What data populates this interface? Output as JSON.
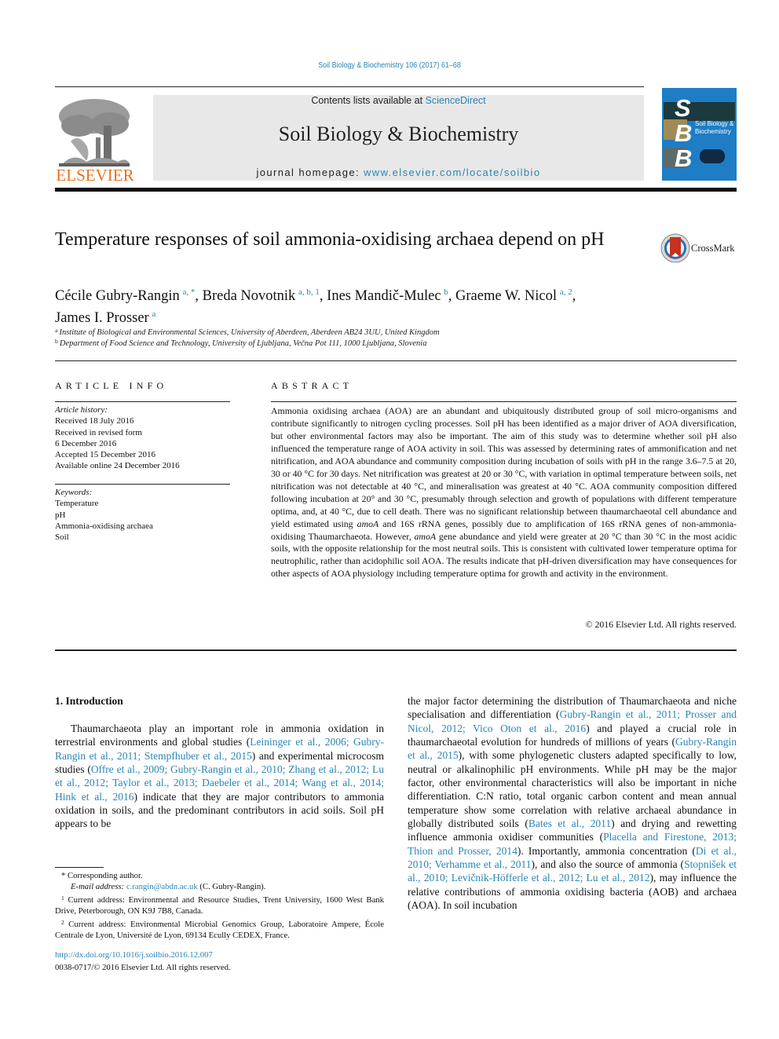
{
  "header": {
    "running_head": "Soil Biology & Biochemistry 106 (2017) 61–68",
    "contents_prefix": "Contents lists available at ",
    "contents_link": "ScienceDirect",
    "journal_title": "Soil Biology & Biochemistry",
    "homepage_prefix": "journal homepage: ",
    "homepage_link": "www.elsevier.com/locate/soilbio",
    "publisher_logo_text": "ELSEVIER",
    "cover": {
      "letters": [
        "S",
        "B",
        "B"
      ],
      "title_line1": "Soil Biology &",
      "title_line2": "Biochemistry"
    },
    "colors": {
      "link": "#2a85b5",
      "elsevier_orange": "#e9711c",
      "cover_blue": "#1e7dc4",
      "banner_gray": "#e8e8e8"
    }
  },
  "article": {
    "title": "Temperature responses of soil ammonia-oxidising archaea depend on pH",
    "crossmark_label": "CrossMark",
    "authors": [
      {
        "name": "Cécile Gubry-Rangin",
        "sup": "a, *",
        "sep": ", "
      },
      {
        "name": "Breda Novotnik",
        "sup": "a, b, 1",
        "sep": ", "
      },
      {
        "name": "Ines Mandič-Mulec",
        "sup": "b",
        "sep": ", "
      },
      {
        "name": "Graeme W. Nicol",
        "sup": "a, 2",
        "sep": ","
      },
      {
        "name": "James I. Prosser",
        "sup": "a",
        "sep": ""
      }
    ],
    "affiliations": [
      {
        "key": "a",
        "text": "Institute of Biological and Environmental Sciences, University of Aberdeen, Aberdeen AB24 3UU, United Kingdom"
      },
      {
        "key": "b",
        "text": "Department of Food Science and Technology, University of Ljubljana, Večna Pot 111, 1000 Ljubljana, Slovenia"
      }
    ]
  },
  "article_info": {
    "heading": "ARTICLE INFO",
    "history_label": "Article history:",
    "history": [
      "Received 18 July 2016",
      "Received in revised form",
      "6 December 2016",
      "Accepted 15 December 2016",
      "Available online 24 December 2016"
    ],
    "keywords_label": "Keywords:",
    "keywords": [
      "Temperature",
      "pH",
      "Ammonia-oxidising archaea",
      "Soil"
    ]
  },
  "abstract": {
    "heading": "ABSTRACT",
    "parts": [
      "Ammonia oxidising archaea (AOA) are an abundant and ubiquitously distributed group of soil micro-organisms and contribute significantly to nitrogen cycling processes. Soil pH has been identified as a major driver of AOA diversification, but other environmental factors may also be important. The aim of this study was to determine whether soil pH also influenced the temperature range of AOA activity in soil. This was assessed by determining rates of ammonification and net nitrification, and AOA abundance and community composition during incubation of soils with pH in the range 3.6–7.5 at 20, 30 or 40 °C for 30 days. Net nitrification was greatest at 20 or 30 °C, with variation in optimal temperature between soils, net nitrification was not detectable at 40 °C, and mineralisation was greatest at 40 °C. AOA community composition differed following incubation at 20° and 30 °C, presumably through selection and growth of populations with different temperature optima, and, at 40 °C, due to cell death. There was no significant relationship between thaumarchaeotal cell abundance and yield estimated using ",
      "amoA",
      " and 16S rRNA genes, possibly due to amplification of 16S rRNA genes of non-ammonia-oxidising Thaumarchaeota. However, ",
      "amoA",
      " gene abundance and yield were greater at 20 °C than 30 °C in the most acidic soils, with the opposite relationship for the most neutral soils. This is consistent with cultivated lower temperature optima for neutrophilic, rather than acidophilic soil AOA. The results indicate that pH-driven diversification may have consequences for other aspects of AOA physiology including temperature optima for growth and activity in the environment."
    ],
    "copyright": "© 2016 Elsevier Ltd. All rights reserved."
  },
  "introduction": {
    "heading": "1.  Introduction",
    "left_column": [
      {
        "t": "Thaumarchaeota play an important role in ammonia oxidation in terrestrial environments and global studies ("
      },
      {
        "t": "Leininger et al., 2006; Gubry-Rangin et al., 2011; Stempfhuber et al., 2015",
        "link": true
      },
      {
        "t": ") and experimental microcosm studies ("
      },
      {
        "t": "Offre et al., 2009; Gubry-Rangin et al., 2010; Zhang et al., 2012; Lu et al., 2012; Taylor et al., 2013; Daebeler et al., 2014; Wang et al., 2014; Hink et al., 2016",
        "link": true
      },
      {
        "t": ") indicate that they are major contributors to ammonia oxidation in soils, and the predominant contributors in acid soils. Soil pH appears to be"
      }
    ],
    "right_column": [
      {
        "t": "the major factor determining the distribution of Thaumarchaeota and niche specialisation and differentiation ("
      },
      {
        "t": "Gubry-Rangin et al., 2011; Prosser and Nicol, 2012; Vico Oton et al., 2016",
        "link": true
      },
      {
        "t": ") and played a crucial role in thaumarchaeotal evolution for hundreds of millions of years ("
      },
      {
        "t": "Gubry-Rangin et al., 2015",
        "link": true
      },
      {
        "t": "), with some phylogenetic clusters adapted specifically to low, neutral or alkalinophilic pH environments. While pH may be the major factor, other environmental characteristics will also be important in niche differentiation. C:N ratio, total organic carbon content and mean annual temperature show some correlation with relative archaeal abundance in globally distributed soils ("
      },
      {
        "t": "Bates et al., 2011",
        "link": true
      },
      {
        "t": ") and drying and rewetting influence ammonia oxidiser communities ("
      },
      {
        "t": "Placella and Firestone, 2013; Thion and Prosser, 2014",
        "link": true
      },
      {
        "t": "). Importantly, ammonia concentration ("
      },
      {
        "t": "Di et al., 2010; Verhamme et al., 2011",
        "link": true
      },
      {
        "t": "), and also the source of ammonia ("
      },
      {
        "t": "Stopnišek et al., 2010; Levičnik-Höfferle et al., 2012; Lu et al., 2012",
        "link": true
      },
      {
        "t": "), may influence the relative contributions of ammonia oxidising bacteria (AOB) and archaea (AOA). In soil incubation"
      }
    ]
  },
  "footnotes": {
    "corresponding": "Corresponding author.",
    "email_label": "E-mail address: ",
    "email": "c.rangin@abdn.ac.uk",
    "email_suffix": " (C. Gubry-Rangin).",
    "fn1": "Current address: Environmental and Resource Studies, Trent University, 1600 West Bank Drive, Peterborough, ON K9J 7B8, Canada.",
    "fn2": "Current address: Environmental Microbial Genomics Group, Laboratoire Ampere, École Centrale de Lyon, Université de Lyon, 69134 Ecully CEDEX, France.",
    "doi": "http://dx.doi.org/10.1016/j.soilbio.2016.12.007",
    "issn": "0038-0717/© 2016 Elsevier Ltd. All rights reserved."
  }
}
